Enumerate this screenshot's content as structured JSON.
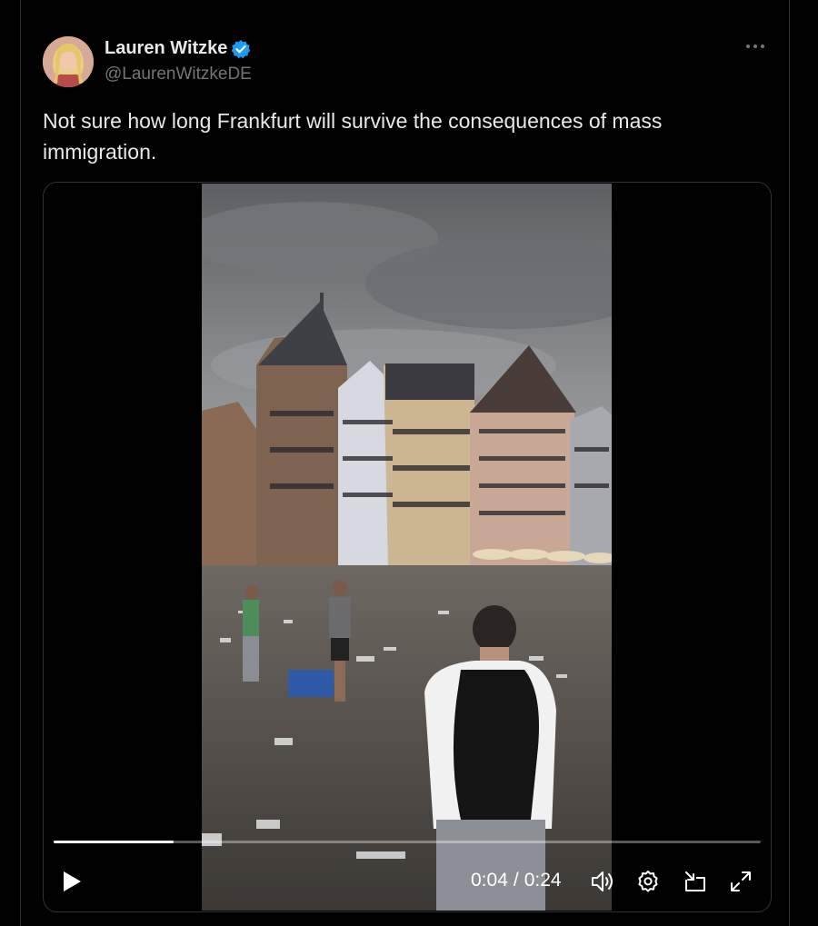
{
  "author": {
    "display_name": "Lauren Witzke",
    "handle": "@LaurenWitzkeDE",
    "verified": true,
    "avatar_icon": "avatar-photo"
  },
  "more_icon": "more-horizontal-icon",
  "tweet": {
    "text": "Not sure how long Frankfurt will survive the consequences of mass immigration."
  },
  "video": {
    "current_time": "0:04",
    "separator": "/",
    "duration": "0:24",
    "progress_fraction": 0.17,
    "play_icon": "play-icon",
    "volume_icon": "volume-icon",
    "settings_icon": "settings-icon",
    "pip_icon": "picture-in-picture-icon",
    "fullscreen_icon": "fullscreen-icon"
  },
  "colors": {
    "background": "#000000",
    "text_primary": "#e7e9ea",
    "text_secondary": "#71767b",
    "verified_blue": "#1d9bf0",
    "border": "#2f3336"
  }
}
